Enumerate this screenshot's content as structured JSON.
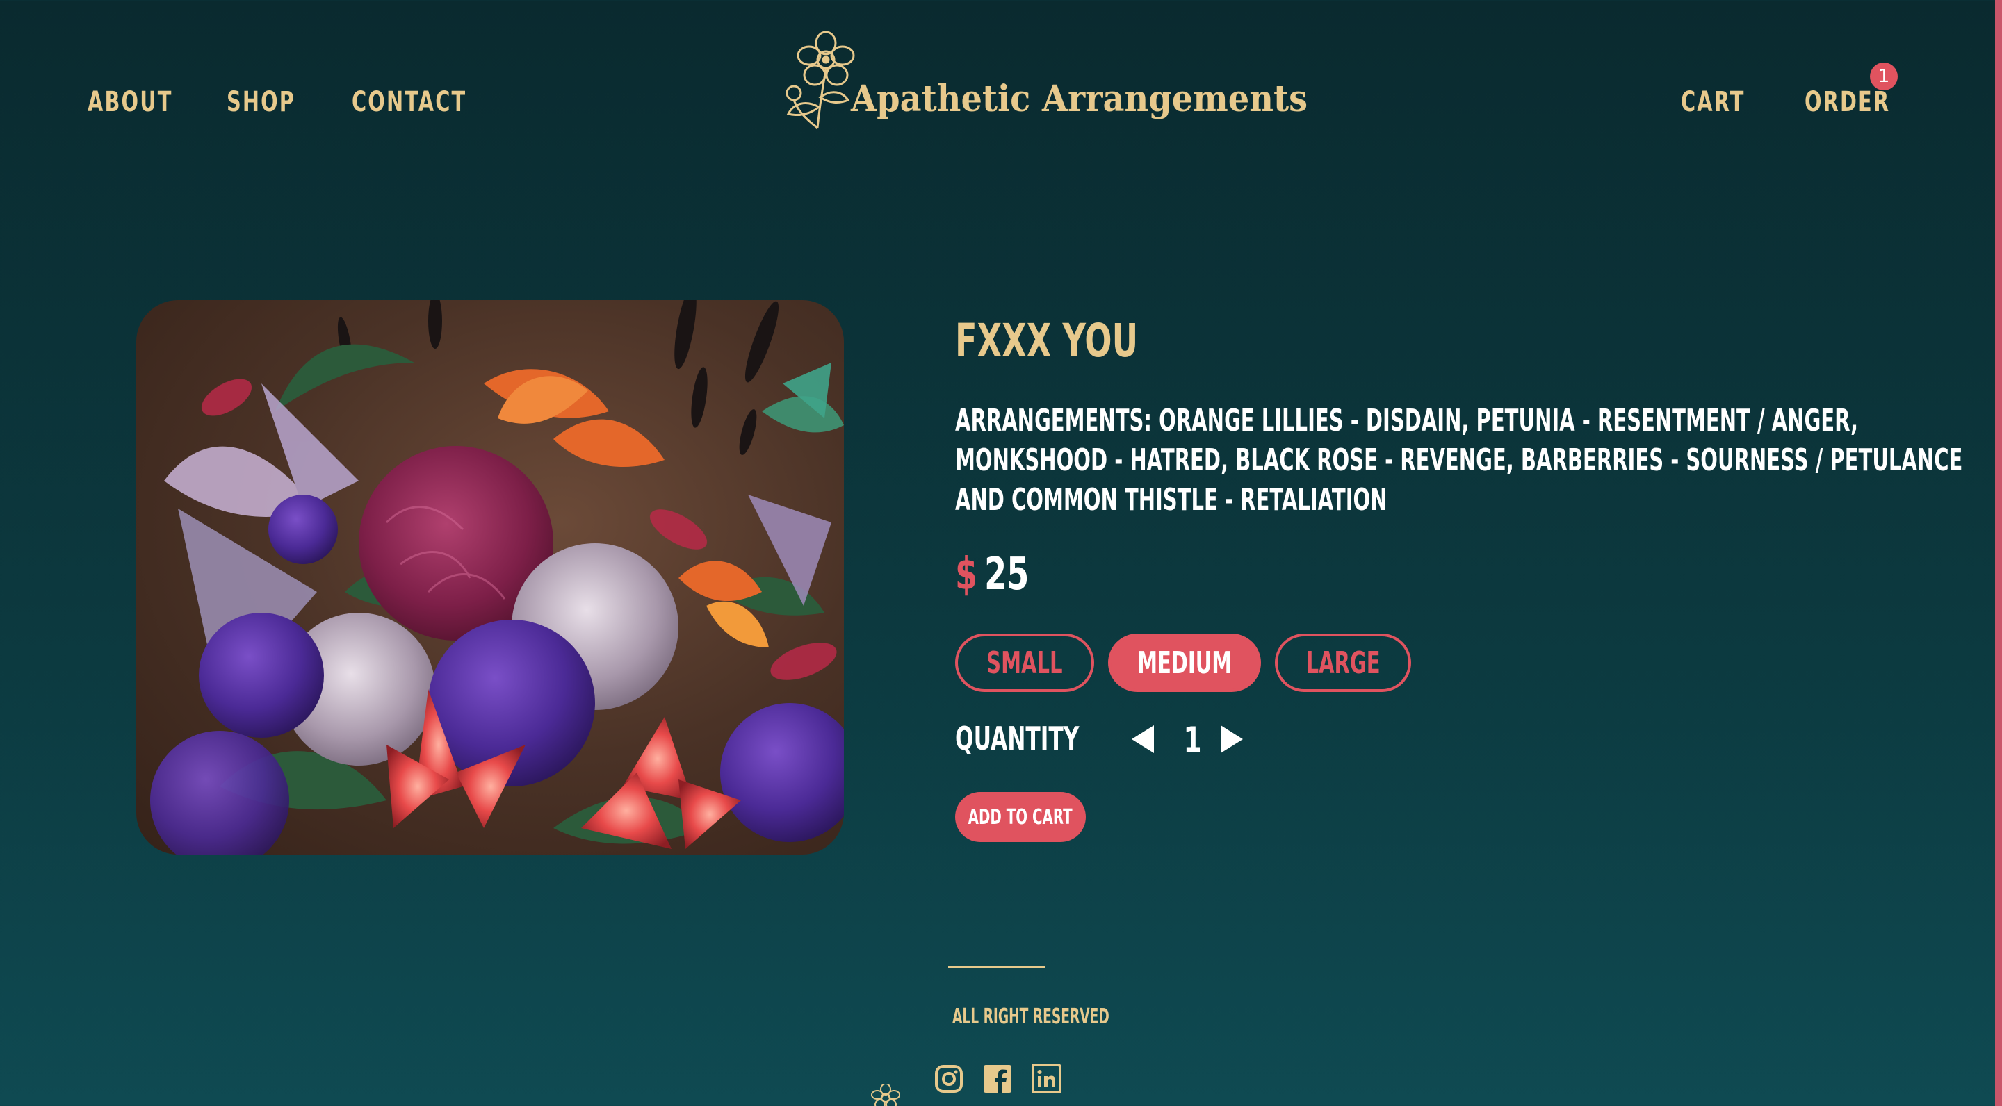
{
  "brand": {
    "name": "Apathetic Arrangements"
  },
  "nav": {
    "left": [
      {
        "label": "ABOUT"
      },
      {
        "label": "SHOP"
      },
      {
        "label": "CONTACT"
      }
    ],
    "right": [
      {
        "label": "CART"
      },
      {
        "label": "ORDER"
      }
    ],
    "order_badge": "1"
  },
  "product": {
    "title": "FXXX YOU",
    "description_lines": [
      "ARRANGEMENTS: ORANGE LILLIES - DISDAIN, PETUNIA - RESENTMENT / ANGER,",
      "MONKSHOOD - HATRED, BLACK ROSE - REVENGE, BARBERRIES - SOURNESS / PETULANCE",
      "AND COMMON THISTLE - RETALIATION"
    ],
    "currency": "$",
    "price": "25",
    "sizes": [
      {
        "label": "SMALL",
        "selected": false
      },
      {
        "label": "MEDIUM",
        "selected": true
      },
      {
        "label": "LARGE",
        "selected": false
      }
    ],
    "quantity_label": "QUANTITY",
    "quantity": "1",
    "add_to_cart_label": "ADD TO CART"
  },
  "footer": {
    "rights": "ALL RIGHT RESERVED",
    "social": [
      "instagram-icon",
      "facebook-icon",
      "linkedin-icon"
    ]
  },
  "colors": {
    "background": "#0a2a2f",
    "accent": "#e0535f",
    "gold": "#e7c98c",
    "text": "#ffffff"
  }
}
